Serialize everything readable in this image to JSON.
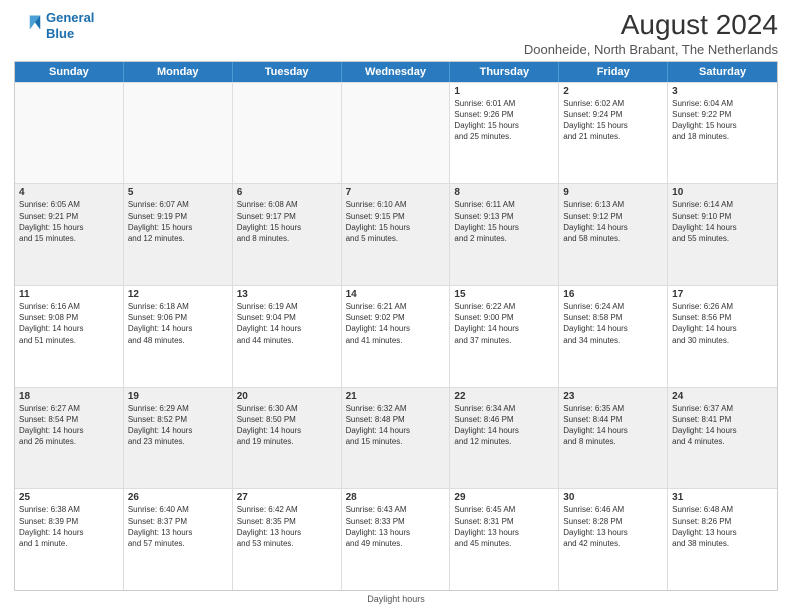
{
  "header": {
    "logo_line1": "General",
    "logo_line2": "Blue",
    "main_title": "August 2024",
    "subtitle": "Doonheide, North Brabant, The Netherlands"
  },
  "days_of_week": [
    "Sunday",
    "Monday",
    "Tuesday",
    "Wednesday",
    "Thursday",
    "Friday",
    "Saturday"
  ],
  "footer": "Daylight hours",
  "weeks": [
    [
      {
        "day": "",
        "info": ""
      },
      {
        "day": "",
        "info": ""
      },
      {
        "day": "",
        "info": ""
      },
      {
        "day": "",
        "info": ""
      },
      {
        "day": "1",
        "info": "Sunrise: 6:01 AM\nSunset: 9:26 PM\nDaylight: 15 hours\nand 25 minutes."
      },
      {
        "day": "2",
        "info": "Sunrise: 6:02 AM\nSunset: 9:24 PM\nDaylight: 15 hours\nand 21 minutes."
      },
      {
        "day": "3",
        "info": "Sunrise: 6:04 AM\nSunset: 9:22 PM\nDaylight: 15 hours\nand 18 minutes."
      }
    ],
    [
      {
        "day": "4",
        "info": "Sunrise: 6:05 AM\nSunset: 9:21 PM\nDaylight: 15 hours\nand 15 minutes."
      },
      {
        "day": "5",
        "info": "Sunrise: 6:07 AM\nSunset: 9:19 PM\nDaylight: 15 hours\nand 12 minutes."
      },
      {
        "day": "6",
        "info": "Sunrise: 6:08 AM\nSunset: 9:17 PM\nDaylight: 15 hours\nand 8 minutes."
      },
      {
        "day": "7",
        "info": "Sunrise: 6:10 AM\nSunset: 9:15 PM\nDaylight: 15 hours\nand 5 minutes."
      },
      {
        "day": "8",
        "info": "Sunrise: 6:11 AM\nSunset: 9:13 PM\nDaylight: 15 hours\nand 2 minutes."
      },
      {
        "day": "9",
        "info": "Sunrise: 6:13 AM\nSunset: 9:12 PM\nDaylight: 14 hours\nand 58 minutes."
      },
      {
        "day": "10",
        "info": "Sunrise: 6:14 AM\nSunset: 9:10 PM\nDaylight: 14 hours\nand 55 minutes."
      }
    ],
    [
      {
        "day": "11",
        "info": "Sunrise: 6:16 AM\nSunset: 9:08 PM\nDaylight: 14 hours\nand 51 minutes."
      },
      {
        "day": "12",
        "info": "Sunrise: 6:18 AM\nSunset: 9:06 PM\nDaylight: 14 hours\nand 48 minutes."
      },
      {
        "day": "13",
        "info": "Sunrise: 6:19 AM\nSunset: 9:04 PM\nDaylight: 14 hours\nand 44 minutes."
      },
      {
        "day": "14",
        "info": "Sunrise: 6:21 AM\nSunset: 9:02 PM\nDaylight: 14 hours\nand 41 minutes."
      },
      {
        "day": "15",
        "info": "Sunrise: 6:22 AM\nSunset: 9:00 PM\nDaylight: 14 hours\nand 37 minutes."
      },
      {
        "day": "16",
        "info": "Sunrise: 6:24 AM\nSunset: 8:58 PM\nDaylight: 14 hours\nand 34 minutes."
      },
      {
        "day": "17",
        "info": "Sunrise: 6:26 AM\nSunset: 8:56 PM\nDaylight: 14 hours\nand 30 minutes."
      }
    ],
    [
      {
        "day": "18",
        "info": "Sunrise: 6:27 AM\nSunset: 8:54 PM\nDaylight: 14 hours\nand 26 minutes."
      },
      {
        "day": "19",
        "info": "Sunrise: 6:29 AM\nSunset: 8:52 PM\nDaylight: 14 hours\nand 23 minutes."
      },
      {
        "day": "20",
        "info": "Sunrise: 6:30 AM\nSunset: 8:50 PM\nDaylight: 14 hours\nand 19 minutes."
      },
      {
        "day": "21",
        "info": "Sunrise: 6:32 AM\nSunset: 8:48 PM\nDaylight: 14 hours\nand 15 minutes."
      },
      {
        "day": "22",
        "info": "Sunrise: 6:34 AM\nSunset: 8:46 PM\nDaylight: 14 hours\nand 12 minutes."
      },
      {
        "day": "23",
        "info": "Sunrise: 6:35 AM\nSunset: 8:44 PM\nDaylight: 14 hours\nand 8 minutes."
      },
      {
        "day": "24",
        "info": "Sunrise: 6:37 AM\nSunset: 8:41 PM\nDaylight: 14 hours\nand 4 minutes."
      }
    ],
    [
      {
        "day": "25",
        "info": "Sunrise: 6:38 AM\nSunset: 8:39 PM\nDaylight: 14 hours\nand 1 minute."
      },
      {
        "day": "26",
        "info": "Sunrise: 6:40 AM\nSunset: 8:37 PM\nDaylight: 13 hours\nand 57 minutes."
      },
      {
        "day": "27",
        "info": "Sunrise: 6:42 AM\nSunset: 8:35 PM\nDaylight: 13 hours\nand 53 minutes."
      },
      {
        "day": "28",
        "info": "Sunrise: 6:43 AM\nSunset: 8:33 PM\nDaylight: 13 hours\nand 49 minutes."
      },
      {
        "day": "29",
        "info": "Sunrise: 6:45 AM\nSunset: 8:31 PM\nDaylight: 13 hours\nand 45 minutes."
      },
      {
        "day": "30",
        "info": "Sunrise: 6:46 AM\nSunset: 8:28 PM\nDaylight: 13 hours\nand 42 minutes."
      },
      {
        "day": "31",
        "info": "Sunrise: 6:48 AM\nSunset: 8:26 PM\nDaylight: 13 hours\nand 38 minutes."
      }
    ]
  ]
}
